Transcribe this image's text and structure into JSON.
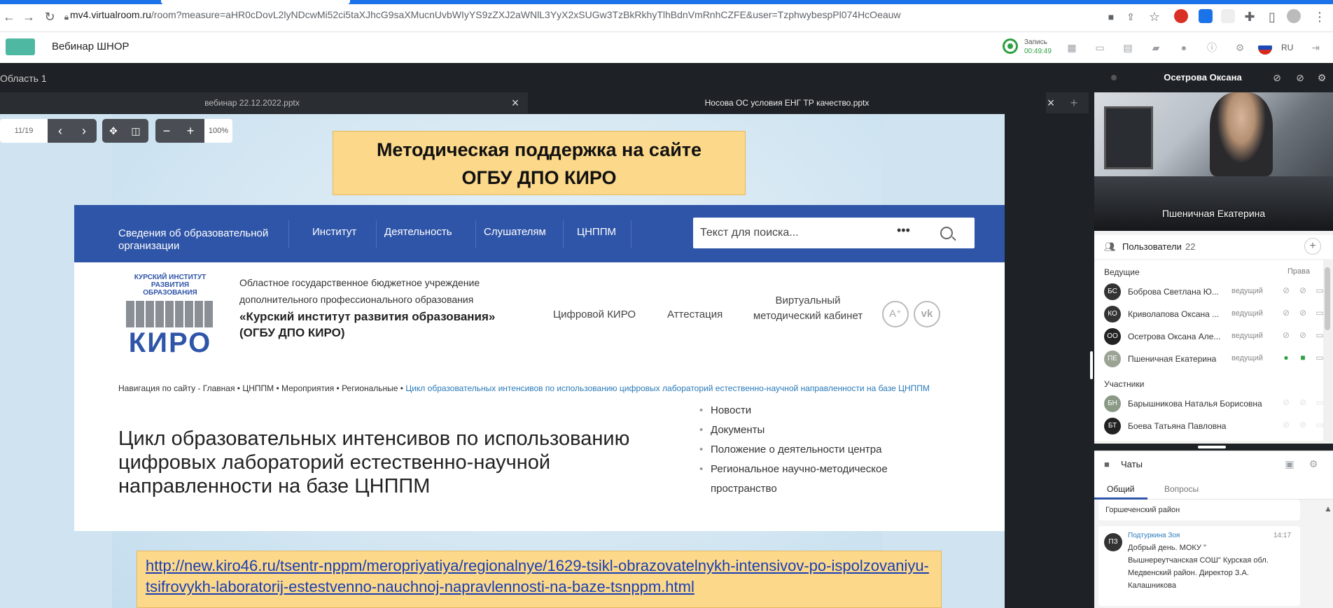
{
  "browser": {
    "url_host": "mv4.virtualroom.ru",
    "url_path": "/room?measure=aHR0cDovL2lyNDcwMi52ci5taXJhcG9saXMucnUvbWIyYS9zZXJ2aWNlL3YyX2xSUGw3TzBkRkhyTlhBdnVmRnhCZFE&user=TzphwybespPl074HcOeauw"
  },
  "app": {
    "title": "Вебинар ШНОР",
    "record_label": "Запись",
    "record_time": "00:49:49",
    "lang": "RU",
    "colors": {
      "accent": "#2f55a8",
      "record": "#2ea043",
      "stage": "#1e2125"
    }
  },
  "stage": {
    "area_title": "Область 1",
    "tabs": [
      {
        "label": "вебинар 22.12.2022.pptx"
      },
      {
        "label": "Носова ОС условия ЕНГ ТР качество.pptx"
      }
    ],
    "toolbar": {
      "page": "11/19",
      "zoom": "100%"
    }
  },
  "slide": {
    "header_line1": "Методическая поддержка на сайте",
    "header_line2": "ОГБУ ДПО КИРО",
    "website": {
      "nav": {
        "item0_line1": "Сведения об образовательной",
        "item0_line2": "организации",
        "item1": "Институт",
        "item2": "Деятельность",
        "item3": "Слушателям",
        "item4": "ЦНППМ"
      },
      "search_placeholder": "Текст для поиска...",
      "search_more": "•••",
      "logo_line1": "КУРСКИЙ ИНСТИТУТ",
      "logo_line2": "РАЗВИТИЯ ОБРАЗОВАНИЯ",
      "logo_brand": "КИРО",
      "org_line1": "Областное государственное бюджетное учреждение",
      "org_line2": "дополнительного профессионального образования",
      "org_line3": "«Курский институт развития образования»",
      "org_line4": "(ОГБУ ДПО КИРО)",
      "links": {
        "l1": "Цифровой КИРО",
        "l2": "Аттестация",
        "l3_line1": "Виртуальный",
        "l3_line2": "методический кабинет"
      },
      "btn_a": "A⁺",
      "btn_vk": "vk",
      "breadcrumb_prefix": "Навигация по сайту - Главная • ЦНППМ • Мероприятия • Региональные • ",
      "breadcrumb_current": "Цикл образовательных интенсивов по использованию цифровых лабораторий естественно-научной направленности на базе ЦНППМ",
      "page_title": "Цикл образовательных интенсивов по использованию цифровых лабораторий естественно-научной направленности на базе ЦНППМ",
      "side_list": {
        "i1": "Новости",
        "i2": "Документы",
        "i3": "Положение о деятельности центра",
        "i4": "Региональное научно-методическое пространство"
      }
    },
    "link": "http://new.kiro46.ru/tsentr-nppm/meropriyatiya/regionalnye/1629-tsikl-obrazovatelnykh-intensivov-po-ispolzovaniyu-tsifrovykh-laboratorij-estestvenno-nauchnoj-napravlennosti-na-baze-tsnppm.html"
  },
  "panel": {
    "camera_owner": "Осетрова Оксана",
    "video_name": "Пшеничная Екатерина",
    "users_label": "Пользователи",
    "users_count": "22",
    "hosts_label": "Ведущие",
    "rights_label": "Права",
    "participants_label": "Участники",
    "hosts": [
      {
        "initials": "БС",
        "name": "Боброва Светлана Ю...",
        "role": "ведущий"
      },
      {
        "initials": "КО",
        "name": "Криволапова Оксана ...",
        "role": "ведущий"
      },
      {
        "initials": "ОО",
        "name": "Осетрова Оксана Але...",
        "role": "ведущий"
      },
      {
        "initials": "ПЕ",
        "name": "Пшеничная Екатерина",
        "role": "ведущий"
      }
    ],
    "participants": [
      {
        "initials": "БН",
        "name": "Барышникова Наталья Борисовна"
      },
      {
        "initials": "БТ",
        "name": "Боева Татьяна Павловна"
      }
    ],
    "chats_label": "Чаты",
    "chat_tabs": {
      "general": "Общий",
      "questions": "Вопросы"
    },
    "messages": {
      "m0_text": "Горшеченский район",
      "m1_initials": "ПЗ",
      "m1_author": "Подтуркина Зоя",
      "m1_time": "14:17",
      "m1_l1": "Добрый день. МОКУ \"",
      "m1_l2": "Вышнереутчанская СОШ\" Курская обл.",
      "m1_l3": "Медвенский район. Директор З.А.",
      "m1_l4": "Калашникова"
    }
  }
}
